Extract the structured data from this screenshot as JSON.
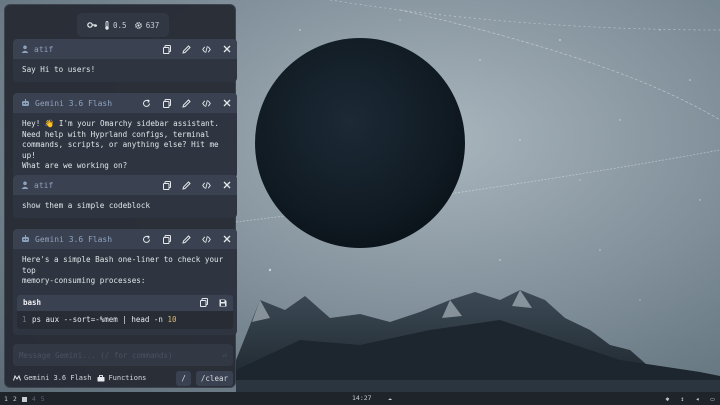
{
  "topbar": {
    "temperature": "0.5",
    "tokens": "637"
  },
  "messages": [
    {
      "author": "atif",
      "body": "Say Hi to users!"
    },
    {
      "author": "Gemini 3.6 Flash",
      "body": "Hey! 👋 I'm your Omarchy sidebar assistant.\nNeed help with Hyprland configs, terminal\ncommands, scripts, or anything else? Hit me up!\nWhat are we working on?"
    },
    {
      "author": "atif",
      "body": "show them a simple codeblock"
    },
    {
      "author": "Gemini 3.6 Flash",
      "body": "Here's a simple Bash one-liner to check your top\nmemory-consuming processes:"
    }
  ],
  "codeblock": {
    "language": "bash",
    "line_number": "1",
    "command": "ps aux --sort=-%mem | head -n ",
    "number": "10"
  },
  "input": {
    "placeholder": "Message Gemini... (/ for commands)"
  },
  "footer": {
    "model": "Gemini 3.6 Flash",
    "functions": "Functions",
    "slash_button": "/",
    "clear_button": "/clear"
  },
  "taskbar": {
    "workspaces": [
      "1",
      "2",
      "3",
      "4",
      "5"
    ],
    "clock": "14:27"
  }
}
